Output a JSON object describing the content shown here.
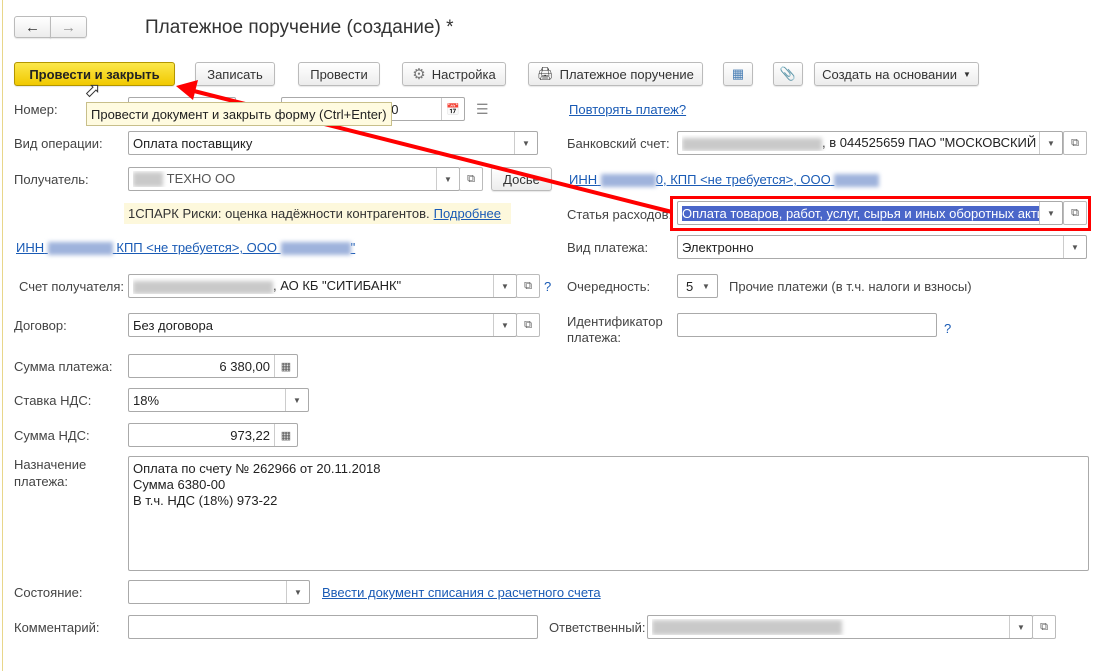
{
  "window": {
    "title": "Платежное поручение (создание) *",
    "back_icon": "arrow-left-icon",
    "forward_icon": "arrow-right-icon"
  },
  "toolbar": {
    "post_close": "Провести и закрыть",
    "save": "Записать",
    "post": "Провести",
    "settings": "Настройка",
    "print": "Платежное поручение",
    "create_based": "Создать на основании"
  },
  "tooltip": "Провести документ и закрыть форму (Ctrl+Enter)",
  "form": {
    "number_label": "Номер:",
    "date_value": "00",
    "repeat_link": "Повторять платеж?",
    "operation_label": "Вид операции:",
    "operation_value": "Оплата поставщику",
    "bank_label": "Банковский счет:",
    "bank_value": ", в 044525659 ПАО \"МОСКОВСКИЙ I",
    "recipient_label": "Получатель:",
    "recipient_value": "ТЕХНО ОО",
    "dossier": "Досье",
    "inn_right_a": "ИНН",
    "inn_right_b": "0, КПП <не требуется>, ООО",
    "spark_text": "1СПАРК Риски: оценка надёжности контрагентов.",
    "spark_link": "Подробнее",
    "expense_label": "Статья расходов:",
    "expense_value": "Оплата товаров, работ, услуг, сырья и иных оборотных активов",
    "inn_left_a": "ИНН",
    "inn_left_b": "КПП <не требуется>, ООО",
    "inn_left_c": "\"",
    "payment_type_label": "Вид платежа:",
    "payment_type_value": "Электронно",
    "account_label": "Счет получателя:",
    "account_value": ", АО КБ \"СИТИБАНК\"",
    "help": "?",
    "priority_label": "Очередность:",
    "priority_value": "5",
    "priority_text": "Прочие платежи (в т.ч. налоги и взносы)",
    "contract_label": "Договор:",
    "contract_value": "Без договора",
    "ident_label_1": "Идентификатор",
    "ident_label_2": "платежа:",
    "ident_value": "",
    "sum_label": "Сумма платежа:",
    "sum_value": "6 380,00",
    "vat_rate_label": "Ставка НДС:",
    "vat_rate_value": "18%",
    "vat_sum_label": "Сумма НДС:",
    "vat_sum_value": "973,22",
    "purpose_label_1": "Назначение",
    "purpose_label_2": "платежа:",
    "purpose_lines": [
      "Оплата по счету № 262966 от 20.11.2018",
      "Сумма 6380-00",
      "В т.ч. НДС  (18%) 973-22"
    ],
    "state_label": "Состояние:",
    "state_value": "",
    "state_link": "Ввести документ списания с расчетного счета",
    "comment_label": "Комментарий:",
    "comment_value": "",
    "responsible_label": "Ответственный:"
  },
  "colors": {
    "primary_button": "#f5d20a",
    "link": "#1a5bb5",
    "highlight": "#4a66c9",
    "annotation": "#ff0000"
  }
}
